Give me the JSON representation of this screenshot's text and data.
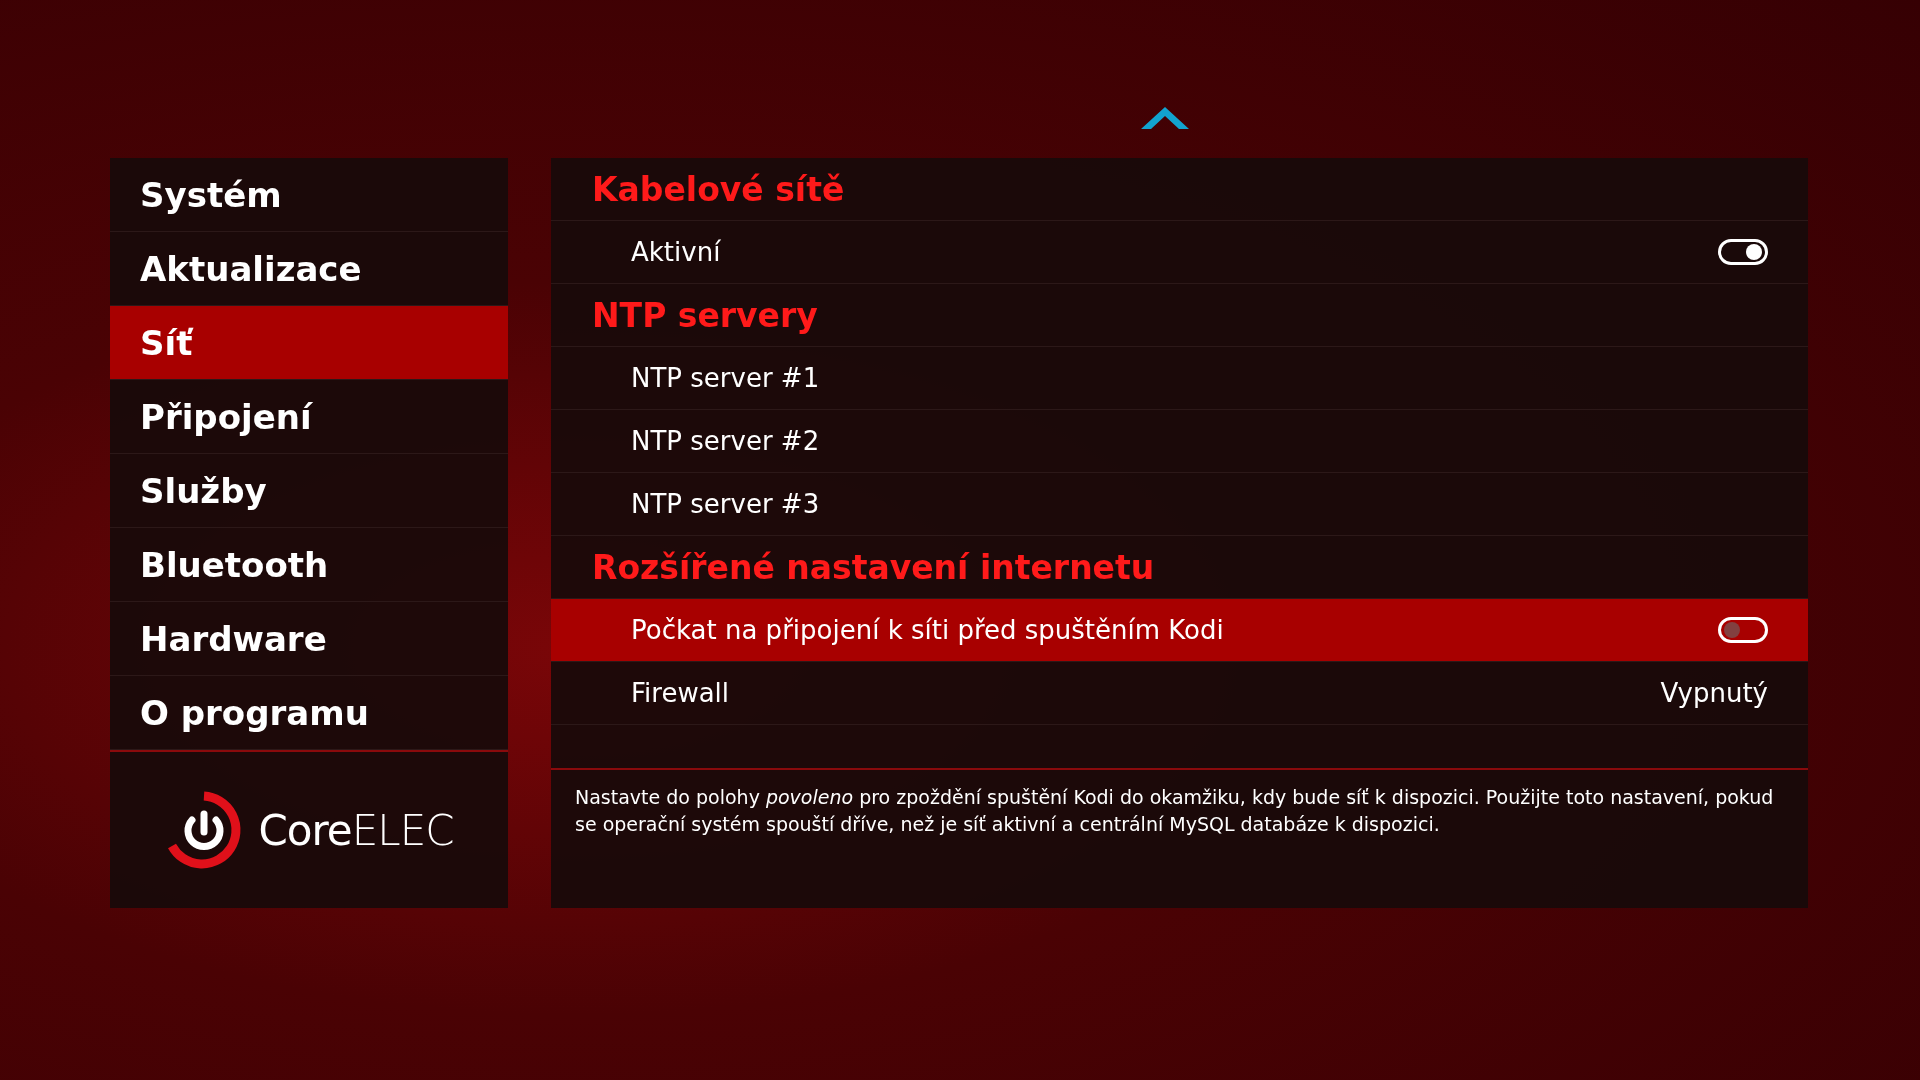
{
  "sidebar": {
    "items": [
      {
        "label": "Systém",
        "selected": false
      },
      {
        "label": "Aktualizace",
        "selected": false
      },
      {
        "label": "Síť",
        "selected": true
      },
      {
        "label": "Připojení",
        "selected": false
      },
      {
        "label": "Služby",
        "selected": false
      },
      {
        "label": "Bluetooth",
        "selected": false
      },
      {
        "label": "Hardware",
        "selected": false
      },
      {
        "label": "O programu",
        "selected": false
      }
    ],
    "logo": "**Core**ELEC"
  },
  "settings": [
    {
      "kind": "header",
      "label": "Kabelové sítě"
    },
    {
      "kind": "toggle",
      "label": "Aktivní",
      "on": true,
      "selected": false
    },
    {
      "kind": "header",
      "label": "NTP servery"
    },
    {
      "kind": "text",
      "label": "NTP server #1",
      "selected": false
    },
    {
      "kind": "text",
      "label": "NTP server #2",
      "selected": false
    },
    {
      "kind": "text",
      "label": "NTP server #3",
      "selected": false
    },
    {
      "kind": "header",
      "label": "Rozšířené nastavení internetu"
    },
    {
      "kind": "toggle",
      "label": "Počkat na připojení k síti před spuštěním Kodi",
      "on": false,
      "selected": true
    },
    {
      "kind": "value",
      "label": "Firewall",
      "value": "Vypnutý",
      "selected": false
    }
  ],
  "description": "Nastavte do polohy *povoleno* pro zpoždění spuštění Kodi do okamžiku, kdy bude síť k dispozici. Použijte toto nastavení, pokud se operační systém spouští dříve, než je síť aktivní a centrální MySQL databáze k dispozici."
}
